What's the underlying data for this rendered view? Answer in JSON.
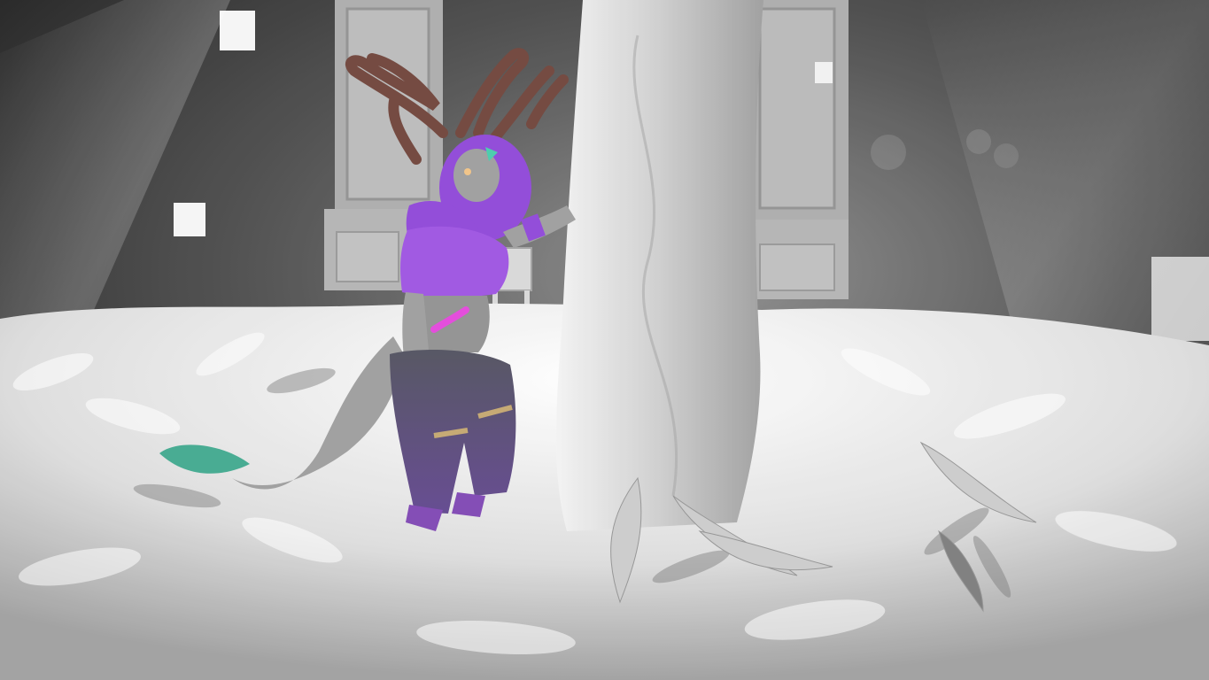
{
  "scene": {
    "kind": "3d-game-screenshot",
    "environment": "indoor-garden-room",
    "palette": {
      "background_dark": "#1e1e1e",
      "wall": "#8f8f8f",
      "foliage": "#e6e6e6",
      "tree_trunk": "#d8d8d8",
      "avatar_purple": "#8a3fd6",
      "avatar_magenta": "#e23fd9",
      "avatar_skin": "#9a9a9a",
      "avatar_antlers": "#6a3c32",
      "accent_teal": "#3fc9a8",
      "leaf_teal": "#3aa58a"
    }
  }
}
